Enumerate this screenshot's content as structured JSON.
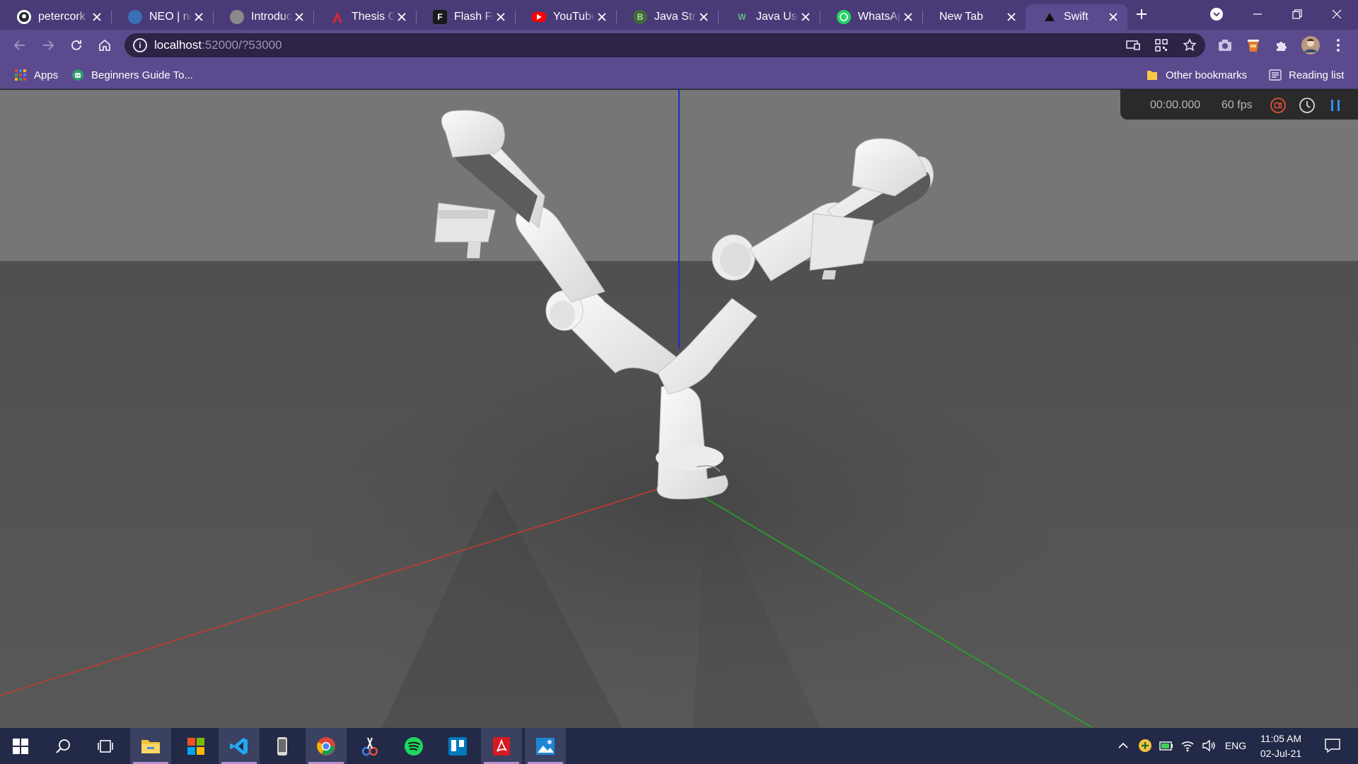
{
  "browser": {
    "tabs": [
      {
        "title": "petercork",
        "favicon": "github-icon",
        "color": "#ffffff"
      },
      {
        "title": "NEO | neo",
        "favicon": "globe-icon",
        "color": "#3b6fb6"
      },
      {
        "title": "Introducti",
        "favicon": "globe-icon",
        "color": "#8a8a8a"
      },
      {
        "title": "Thesis Ge",
        "favicon": "arizona-icon",
        "color": "#cc2a3a"
      },
      {
        "title": "Flash Ficti",
        "favicon": "f-icon",
        "color": "#1a1a1a"
      },
      {
        "title": "YouTube",
        "favicon": "youtube-icon",
        "color": "#ff0000"
      },
      {
        "title": "Java Strin",
        "favicon": "b-icon",
        "color": "#3e6b3a"
      },
      {
        "title": "Java User",
        "favicon": "w-icon",
        "color": "#2f6b4f"
      },
      {
        "title": "WhatsApp",
        "favicon": "whatsapp-icon",
        "color": "#25d366"
      },
      {
        "title": "New Tab",
        "favicon": "",
        "color": ""
      },
      {
        "title": "Swift",
        "favicon": "swift-icon",
        "color": "#111111",
        "active": true
      }
    ],
    "address": {
      "host": "localhost",
      "rest": ":52000/?53000"
    },
    "bookmarks": {
      "apps": "Apps",
      "guide": "Beginners Guide To...",
      "other": "Other bookmarks",
      "reading": "Reading list"
    }
  },
  "swift": {
    "time": "00:00.000",
    "fps": "60 fps",
    "controls": [
      "record-icon",
      "clock-icon",
      "pause-icon"
    ],
    "scene": {
      "content": "Franka Emika Panda dual robot arms on pedestal",
      "axes": {
        "x": "#d33a2c",
        "y": "#1fae1f",
        "z": "#1a2bd6"
      },
      "background_upper": "#757575",
      "floor": "#545454"
    }
  },
  "taskbar": {
    "apps": [
      "start-icon",
      "search-icon",
      "task-view-icon",
      "file-explorer-icon",
      "microsoft-store-icon",
      "vscode-icon",
      "phone-icon",
      "chrome-icon",
      "snipping-tool-icon",
      "spotify-icon",
      "trello-icon",
      "acrobat-icon",
      "photos-icon"
    ],
    "language": "ENG",
    "time": "11:05 AM",
    "date": "02-Jul-21"
  }
}
